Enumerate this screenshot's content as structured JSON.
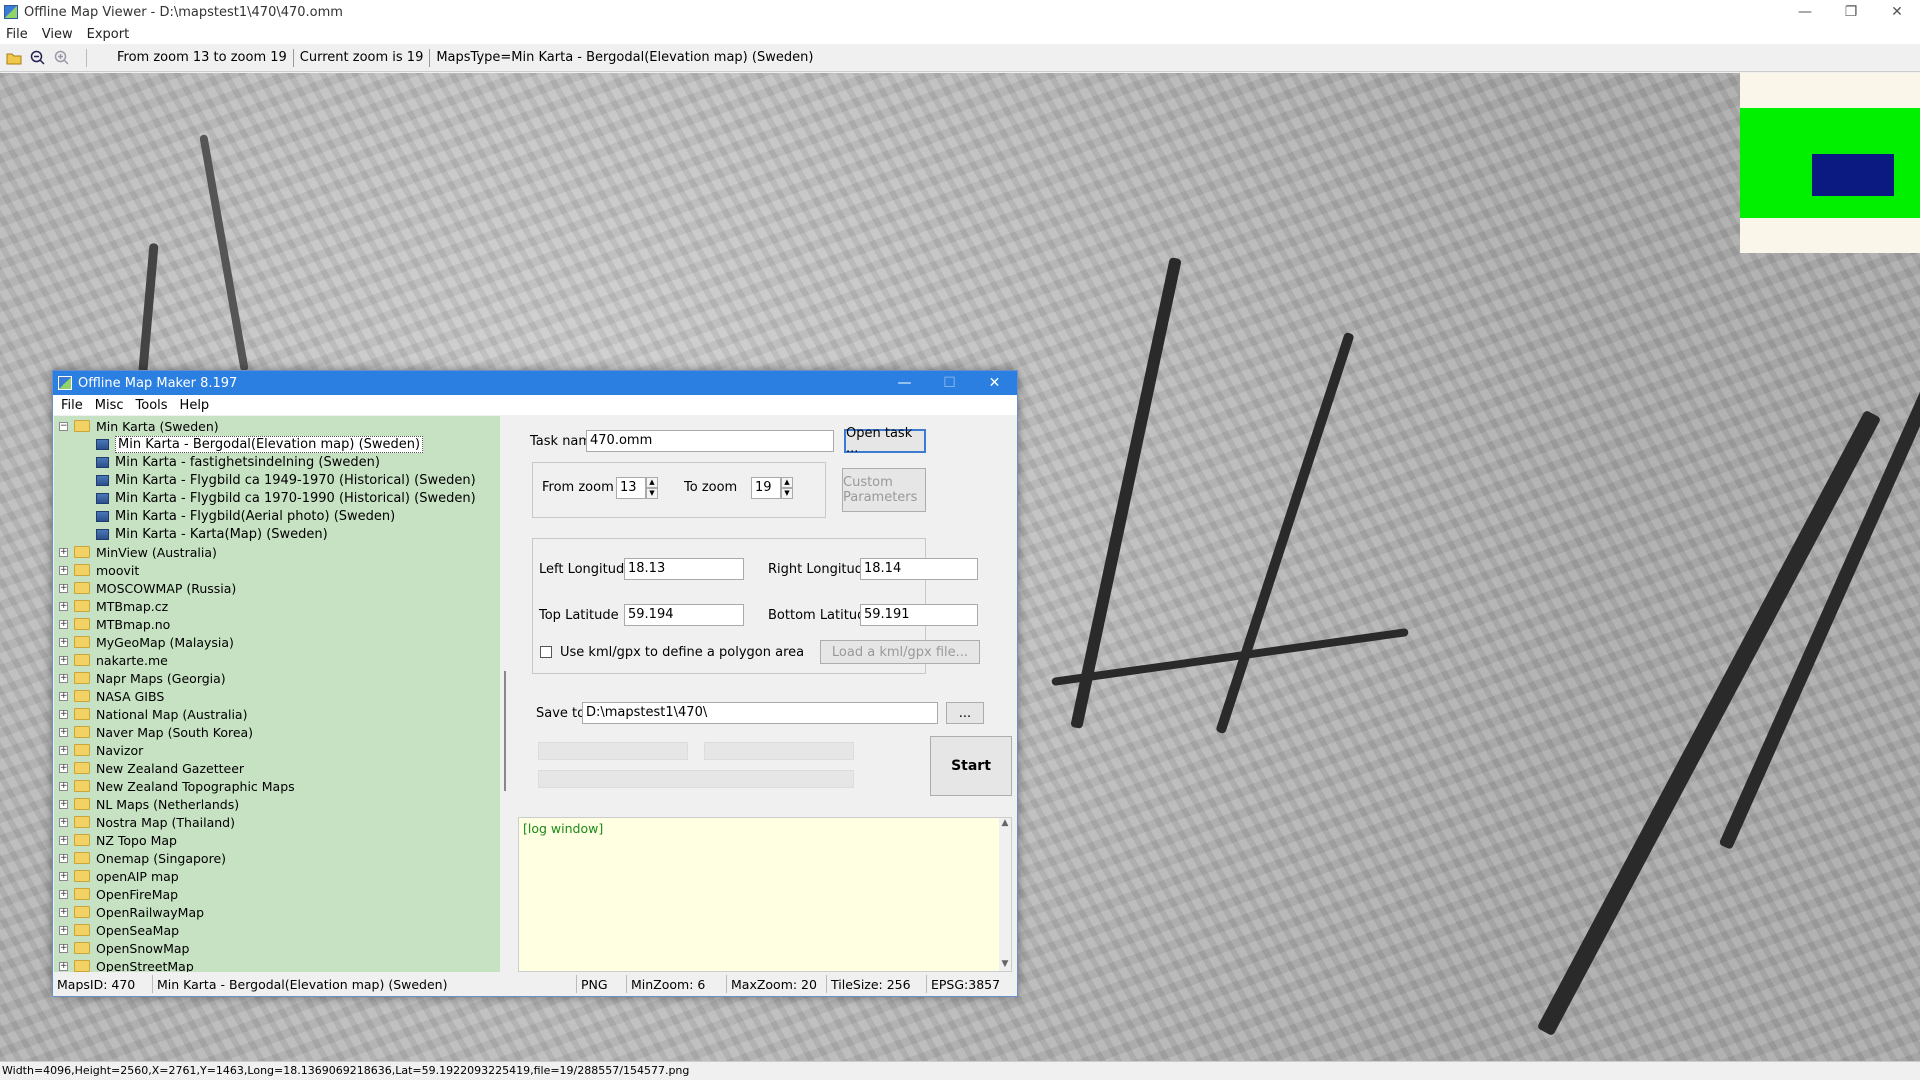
{
  "viewer": {
    "title": "Offline Map Viewer - D:\\mapstest1\\470\\470.omm",
    "menu": [
      "File",
      "View",
      "Export"
    ],
    "toolbar": {
      "zoom_range": "From zoom 13 to zoom 19",
      "current_zoom": "Current zoom is 19",
      "maps_type": "MapsType=Min Karta - Bergodal(Elevation map) (Sweden)"
    },
    "status": "Width=4096,Height=2560,X=2761,Y=1463,Long=18.1369069218636,Lat=59.1922093225419,file=19/288557/154577.png"
  },
  "dialog": {
    "title": "Offline Map Maker 8.197",
    "menu": [
      "File",
      "Misc",
      "Tools",
      "Help"
    ],
    "tree": {
      "root": "Min Karta (Sweden)",
      "children": [
        "Min Karta - Bergodal(Elevation map) (Sweden)",
        "Min Karta - fastighetsindelning (Sweden)",
        "Min Karta - Flygbild ca 1949-1970 (Historical) (Sweden)",
        "Min Karta - Flygbild ca 1970-1990 (Historical) (Sweden)",
        "Min Karta - Flygbild(Aerial photo) (Sweden)",
        "Min Karta - Karta(Map) (Sweden)"
      ],
      "folders": [
        "MinView (Australia)",
        "moovit",
        "MOSCOWMAP (Russia)",
        "MTBmap.cz",
        "MTBmap.no",
        "MyGeoMap (Malaysia)",
        "nakarte.me",
        "Napr Maps (Georgia)",
        "NASA GIBS",
        "National Map (Australia)",
        "Naver Map (South Korea)",
        "Navizor",
        "New Zealand Gazetteer",
        "New Zealand Topographic Maps",
        "NL Maps (Netherlands)",
        "Nostra Map (Thailand)",
        "NZ Topo Map",
        "Onemap (Singapore)",
        "openAIP map",
        "OpenFireMap",
        "OpenRailwayMap",
        "OpenSeaMap",
        "OpenSnowMap",
        "OpenStreetMap"
      ]
    },
    "form": {
      "task_name_label": "Task name",
      "task_name_value": "470.omm",
      "open_task": "Open task ...",
      "from_zoom_label": "From zoom",
      "from_zoom_value": "13",
      "to_zoom_label": "To zoom",
      "to_zoom_value": "19",
      "custom_params": "Custom Parameters",
      "left_lon_label": "Left Longitude",
      "left_lon_value": "18.13",
      "right_lon_label": "Right Longitude",
      "right_lon_value": "18.14",
      "top_lat_label": "Top Latitude",
      "top_lat_value": "59.194",
      "bottom_lat_label": "Bottom Latitude",
      "bottom_lat_value": "59.191",
      "kml_label": "Use kml/gpx to define a polygon area",
      "load_kml": "Load a kml/gpx file...",
      "save_to_label": "Save to:",
      "save_to_value": "D:\\mapstest1\\470\\",
      "browse": "...",
      "start": "Start"
    },
    "log": "[log window]",
    "status": {
      "maps_id": "MapsID: 470",
      "maps_name": "Min Karta - Bergodal(Elevation map) (Sweden)",
      "format": "PNG",
      "min_zoom": "MinZoom: 6",
      "max_zoom": "MaxZoom: 20",
      "tile_size": "TileSize: 256",
      "epsg": "EPSG:3857"
    }
  },
  "colors": {
    "dialog_title": "#2b7fe0",
    "tree_bg": "#c7e2c3",
    "log_bg": "#ffffe1",
    "log_text": "#1a8a1a",
    "minimap_green": "#00f000",
    "minimap_view": "#0a1a80"
  }
}
